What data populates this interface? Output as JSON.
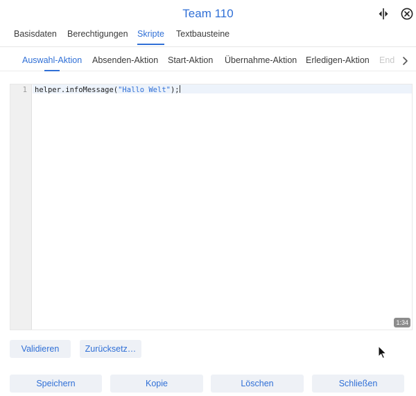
{
  "header": {
    "title": "Team 110",
    "split_icon": "split-view-icon",
    "close_icon": "close-circle-icon"
  },
  "tabs_primary": [
    {
      "label": "Basisdaten"
    },
    {
      "label": "Berechtigungen"
    },
    {
      "label": "Skripte",
      "active": true
    },
    {
      "label": "Textbausteine"
    }
  ],
  "tabs_secondary": [
    {
      "label": "Auswahl-Aktion",
      "active": true
    },
    {
      "label": "Absenden-Aktion"
    },
    {
      "label": "Start-Aktion"
    },
    {
      "label": "Übernahme-Aktion"
    },
    {
      "label": "Erledigen-Aktion"
    },
    {
      "label": "End"
    }
  ],
  "editor": {
    "line_numbers": [
      "1"
    ],
    "code_prefix": "helper.infoMessage(",
    "code_string": "\"Hallo Welt\"",
    "code_suffix": ");",
    "cursor_position": "1:34"
  },
  "buttons": {
    "validate": "Validieren",
    "reset": "Zurücksetz…",
    "save": "Speichern",
    "copy": "Kopie",
    "delete": "Löschen",
    "close": "Schließen"
  },
  "colors": {
    "accent": "#2f6fd6",
    "button_bg": "#eef1f6",
    "gutter_bg": "#f0f0f0",
    "badge_bg": "#8c8c8c"
  }
}
